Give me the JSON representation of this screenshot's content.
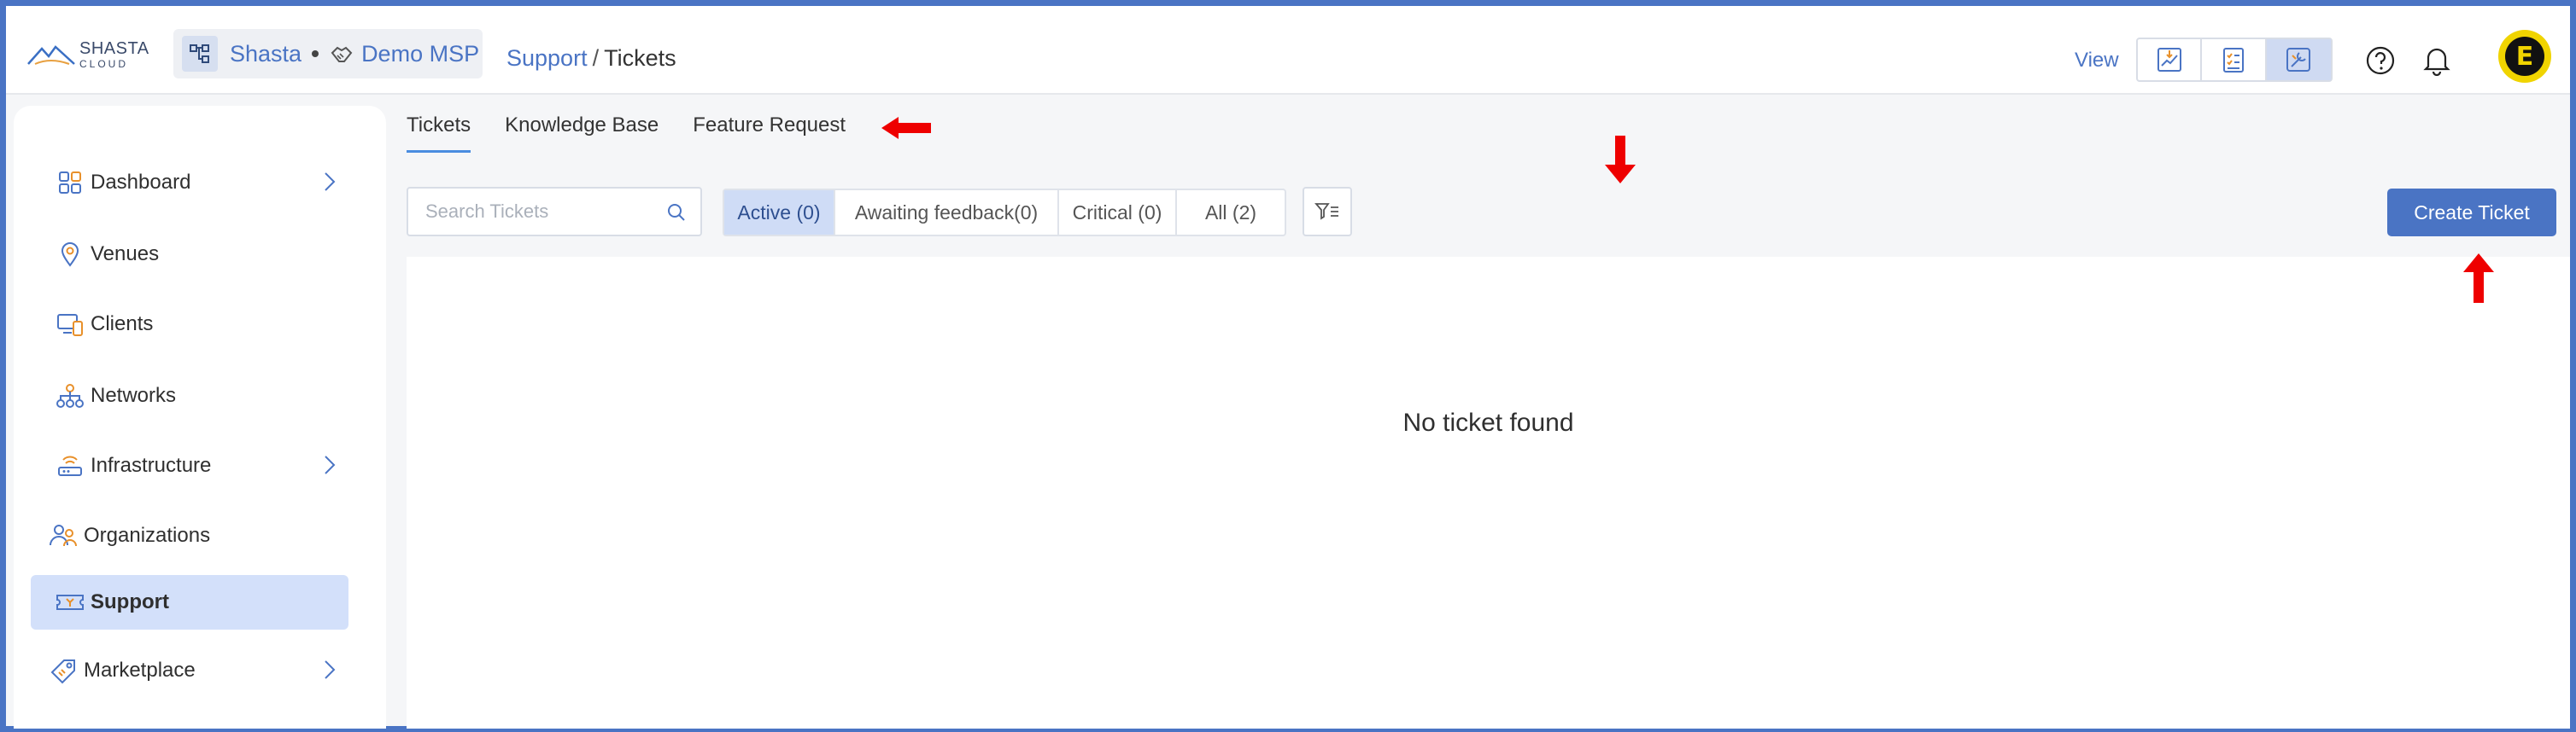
{
  "brand": {
    "logo_line1": "SHASTA",
    "logo_line2": "CLOUD"
  },
  "org": {
    "tenant": "Shasta",
    "org_name": "Demo MSP"
  },
  "breadcrumb": {
    "section": "Support",
    "separator": "/",
    "page": "Tickets"
  },
  "header": {
    "view_label": "View",
    "avatar_letter": "E"
  },
  "sidebar": {
    "items": [
      {
        "label": "Dashboard",
        "icon": "dashboard-icon",
        "has_chevron": true
      },
      {
        "label": "Venues",
        "icon": "location-pin-icon",
        "has_chevron": false
      },
      {
        "label": "Clients",
        "icon": "clients-devices-icon",
        "has_chevron": false
      },
      {
        "label": "Networks",
        "icon": "network-tree-icon",
        "has_chevron": false
      },
      {
        "label": "Infrastructure",
        "icon": "router-icon",
        "has_chevron": true
      },
      {
        "label": "Organizations",
        "icon": "organizations-icon",
        "has_chevron": false
      },
      {
        "label": "Support",
        "icon": "ticket-icon",
        "has_chevron": false,
        "active": true
      },
      {
        "label": "Marketplace",
        "icon": "tag-icon",
        "has_chevron": true
      }
    ]
  },
  "tabs": [
    {
      "label": "Tickets",
      "active": true
    },
    {
      "label": "Knowledge Base",
      "active": false
    },
    {
      "label": "Feature Request",
      "active": false
    }
  ],
  "search": {
    "placeholder": "Search Tickets",
    "value": ""
  },
  "filters": [
    {
      "label": "Active (0)",
      "selected": true
    },
    {
      "label": "Awaiting feedback(0)",
      "selected": false
    },
    {
      "label": "Critical (0)",
      "selected": false
    },
    {
      "label": "All (2)",
      "selected": false
    }
  ],
  "actions": {
    "create_label": "Create Ticket"
  },
  "empty_state": {
    "message": "No ticket found"
  },
  "colors": {
    "accent": "#4a74c4",
    "active_nav": "#d3e0fa",
    "frame": "#4a74c4",
    "annotation_arrow": "#ee0000",
    "avatar_bg": "#f0d400"
  }
}
